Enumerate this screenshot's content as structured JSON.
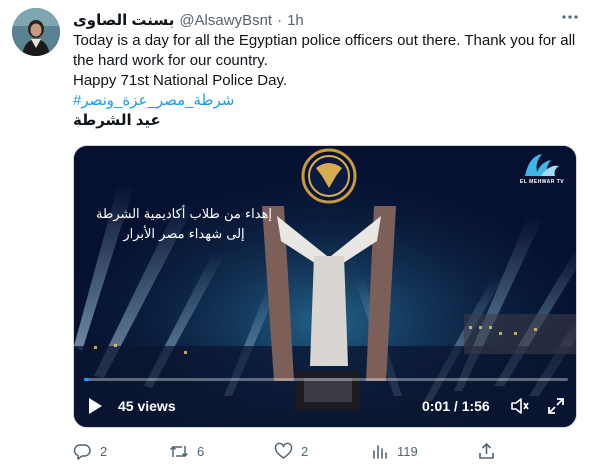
{
  "tweet": {
    "display_name": "بسنت الصاوى",
    "handle": "@AlsawyBsnt",
    "separator": "·",
    "time": "1h",
    "text_lines": [
      "Today is a day for all the Egyptian police officers out there. Thank you for all",
      "the hard work for our country.",
      "Happy 71st National Police Day."
    ],
    "hashtag": "#شرطة_مصر_عزة_ونصر",
    "arabic_line": "عيد الشرطة"
  },
  "video": {
    "overlay_line1": "إهداء من طلاب أكاديمية الشرطة",
    "overlay_line2": "إلى شهداء مصر الأبرار",
    "channel_name": "EL MEHWAR TV",
    "views": "45 views",
    "timecode": "0:01 / 1:56",
    "progress_fraction": 0.01
  },
  "actions": {
    "replies": "2",
    "retweets": "6",
    "likes": "2",
    "views": "119"
  },
  "icons": {
    "more": "more-dots-icon",
    "reply": "reply-icon",
    "retweet": "retweet-icon",
    "like": "heart-icon",
    "analytics": "analytics-icon",
    "share": "share-icon",
    "play": "play-icon",
    "volume": "volume-icon",
    "fullscreen": "fullscreen-icon"
  },
  "colors": {
    "text": "#0f1419",
    "secondary": "#536471",
    "accent": "#1d9bf0"
  }
}
